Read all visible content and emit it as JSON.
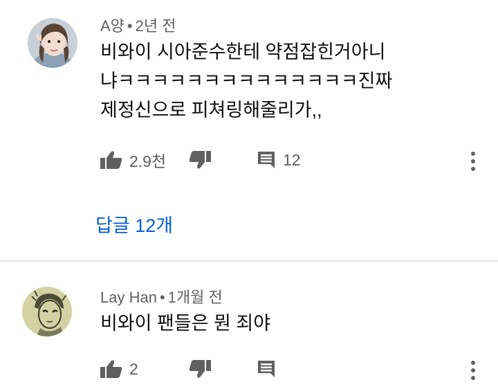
{
  "comments": [
    {
      "author": "A양",
      "separator": "•",
      "time": "2년 전",
      "text": "비와이 시아준수한테 약점잡힌거아니\n냐ㅋㅋㅋㅋㅋㅋㅋㅋㅋㅋㅋㅋㅋㅋ진짜\n제정신으로 피쳐링해줄리가,,",
      "likes": "2.9천",
      "reply_count": "12",
      "view_replies": "답글 12개"
    },
    {
      "author": "Lay Han",
      "separator": "•",
      "time": "1개월 전",
      "text": "비와이 팬들은 뭔 죄야",
      "likes": "2",
      "reply_count": ""
    }
  ],
  "icons": {
    "like": "thumbs-up-icon",
    "dislike": "thumbs-down-icon",
    "reply": "comment-icon",
    "more": "more-vert-icon"
  },
  "colors": {
    "link": "#065fd4",
    "meta": "#606060",
    "icon": "#606060"
  }
}
